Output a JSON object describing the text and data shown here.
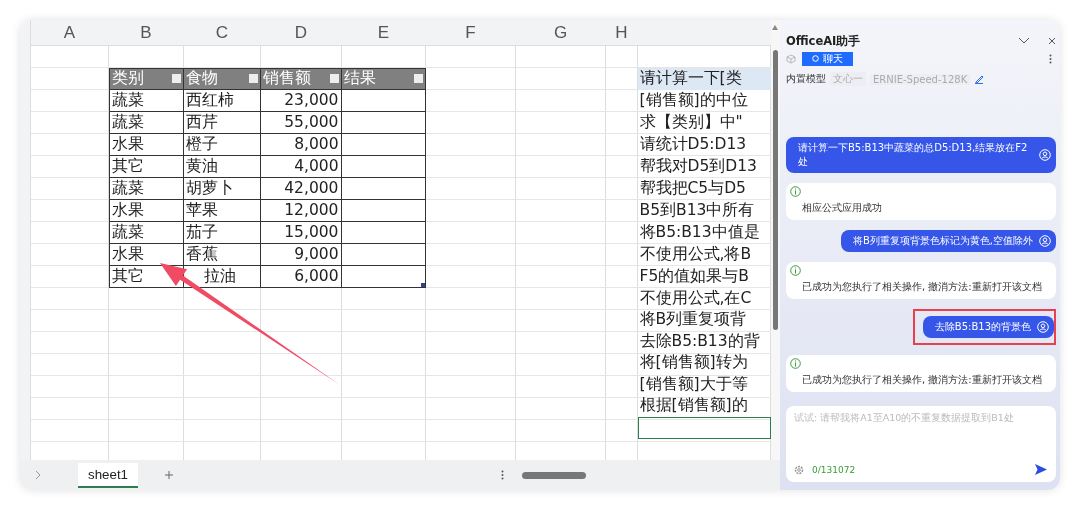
{
  "sheet": {
    "columns": [
      "A",
      "B",
      "C",
      "D",
      "E",
      "F",
      "G",
      "H"
    ],
    "table": {
      "columns": [
        "类别",
        "食物",
        "销售额",
        "结果"
      ],
      "rows": [
        [
          "蔬菜",
          "西红柿",
          "23,000"
        ],
        [
          "蔬菜",
          "西芹",
          "55,000"
        ],
        [
          "水果",
          "橙子",
          "8,000"
        ],
        [
          "其它",
          "黄油",
          "4,000"
        ],
        [
          "蔬菜",
          "胡萝卜",
          "42,000"
        ],
        [
          "水果",
          "苹果",
          "12,000"
        ],
        [
          "蔬菜",
          "茄子",
          "15,000"
        ],
        [
          "水果",
          "香蕉",
          "9,000"
        ],
        [
          "其它",
          "拉油",
          "6,000"
        ]
      ]
    },
    "prompt_cells": [
      {
        "text": "请计算一下[类",
        "highlighted": true
      },
      {
        "text": "[销售额]的中位",
        "highlighted": false
      },
      {
        "text": "求【类别】中\"",
        "highlighted": false
      },
      {
        "text": "请统计D5:D13",
        "highlighted": false
      },
      {
        "text": "帮我对D5到D13",
        "highlighted": false
      },
      {
        "text": "帮我把C5与D5",
        "highlighted": false
      },
      {
        "text": "B5到B13中所有",
        "highlighted": false
      },
      {
        "text": "将B5:B13中值是",
        "highlighted": false
      },
      {
        "text": "不使用公式,将B",
        "highlighted": false
      },
      {
        "text": "F5的值如果与B",
        "highlighted": false
      },
      {
        "text": "不使用公式,在C",
        "highlighted": false
      },
      {
        "text": "将B列重复项背",
        "highlighted": false
      },
      {
        "text": "去除B5:B13的背",
        "highlighted": false
      },
      {
        "text": "将[销售额]转为",
        "highlighted": false
      },
      {
        "text": "[销售额]大于等",
        "highlighted": false
      },
      {
        "text": "根据[销售额]的",
        "highlighted": false
      }
    ],
    "tabs": [
      {
        "label": "sheet1",
        "selected": true
      }
    ]
  },
  "assistant": {
    "title": "OfficeAI助手",
    "mode": {
      "label": "聊天",
      "selected": true
    },
    "model_label": "内置模型",
    "model_tags": [
      "文心一",
      "ERNIE-Speed-128K"
    ],
    "messages": [
      {
        "kind": "user",
        "text": "请计算一下B5:B13中蔬菜的总D5:D13,结果放在F2处",
        "highlighted": false
      },
      {
        "kind": "assistant",
        "text": "相应公式应用成功",
        "highlighted": false
      },
      {
        "kind": "user",
        "text": "将B列重复项背景色标记为黄色,空值除外",
        "highlighted": false
      },
      {
        "kind": "assistant",
        "text": "已成功为您执行了相关操作, 撤消方法:重新打开该文档",
        "highlighted": false
      },
      {
        "kind": "user",
        "text": "去除B5:B13的背景色",
        "highlighted": true
      },
      {
        "kind": "assistant",
        "text": "已成功为您执行了相关操作, 撤消方法:重新打开该文档",
        "highlighted": false
      }
    ],
    "input": {
      "placeholder": "试试: 请帮我将A1至A10的不重复数据提取到B1处",
      "counter": "0/131072"
    }
  }
}
